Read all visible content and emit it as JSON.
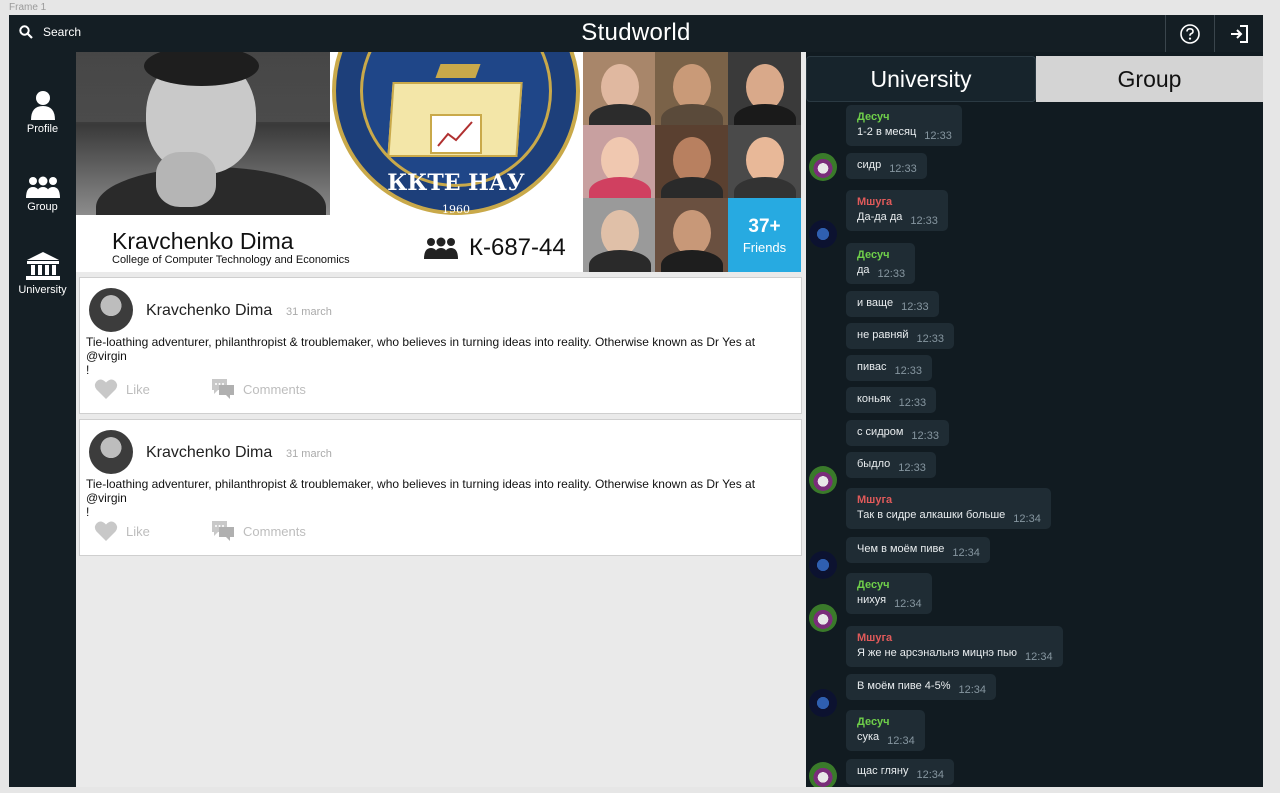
{
  "frame_label": "Frame 1",
  "topbar": {
    "search_label": "Search",
    "title": "Studworld"
  },
  "sidebar": {
    "items": [
      {
        "label": "Profile",
        "icon": "person-icon"
      },
      {
        "label": "Group",
        "icon": "group-icon"
      },
      {
        "label": "University",
        "icon": "university-icon"
      }
    ]
  },
  "profile": {
    "name": "Kravchenko Dima",
    "college": "College of Computer Technology and Economics",
    "group_code": "К-687-44",
    "seal_name": "ККТЕ НАУ",
    "seal_year": "1960",
    "friends_count": "37+",
    "friends_label": "Friends"
  },
  "posts": [
    {
      "author": "Kravchenko Dima",
      "date": "31 march",
      "text_line1": "Tie-loathing adventurer, philanthropist & troublemaker, who believes in turning ideas into reality. Otherwise known as Dr Yes at",
      "text_line2": "@virgin",
      "text_line3": "!",
      "like_label": "Like",
      "comments_label": "Comments"
    },
    {
      "author": "Kravchenko Dima",
      "date": "31 march",
      "text_line1": "Tie-loathing adventurer, philanthropist & troublemaker, who believes in turning ideas into reality. Otherwise known as Dr Yes at",
      "text_line2": "@virgin",
      "text_line3": "!",
      "like_label": "Like",
      "comments_label": "Comments"
    }
  ],
  "chat": {
    "tabs": {
      "university": "University",
      "group": "Group"
    },
    "colors": {
      "sender_green": "#6fcf4a",
      "sender_red": "#e05a5a",
      "bubble": "#1f2c34",
      "background": "#111b21"
    },
    "messages": [
      {
        "sender": "Десуч",
        "text": "1-2 в месяц",
        "time": "12:33"
      },
      {
        "sender": "",
        "text": "сидр",
        "time": "12:33"
      },
      {
        "sender": "Мшуга",
        "text": "Да-да да",
        "time": "12:33"
      },
      {
        "sender": "Десуч",
        "text": "да",
        "time": "12:33"
      },
      {
        "sender": "",
        "text": "и ваще",
        "time": "12:33"
      },
      {
        "sender": "",
        "text": "не равняй",
        "time": "12:33"
      },
      {
        "sender": "",
        "text": "пивас",
        "time": "12:33"
      },
      {
        "sender": "",
        "text": "коньяк",
        "time": "12:33"
      },
      {
        "sender": "",
        "text": "с сидром",
        "time": "12:33"
      },
      {
        "sender": "",
        "text": "быдло",
        "time": "12:33"
      },
      {
        "sender": "Мшуга",
        "text": "Так в сидре алкашки больше",
        "time": "12:34"
      },
      {
        "sender": "",
        "text": "Чем в моём пиве",
        "time": "12:34"
      },
      {
        "sender": "Десуч",
        "text": "нихуя",
        "time": "12:34"
      },
      {
        "sender": "Мшуга",
        "text": "Я же не арсэнальнэ мицнэ пью",
        "time": "12:34"
      },
      {
        "sender": "",
        "text": "В моём пиве 4-5%",
        "time": "12:34"
      },
      {
        "sender": "Десуч",
        "text": "сука",
        "time": "12:34"
      },
      {
        "sender": "",
        "text": "щас гляну",
        "time": "12:34"
      }
    ]
  }
}
